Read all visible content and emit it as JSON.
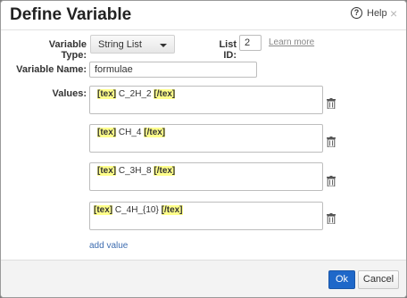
{
  "dialog": {
    "title": "Define Variable",
    "help_label": "Help",
    "close_glyph": "×"
  },
  "form": {
    "variable_type_label": "Variable Type:",
    "variable_type_value": "String List",
    "list_id_label": "List ID:",
    "list_id_value": "2",
    "learn_more": "Learn more",
    "variable_name_label": "Variable Name:",
    "variable_name_value": "formulae",
    "values_label": "Values:",
    "values": [
      {
        "open": "[tex]",
        "text": " C_2H_2 ",
        "close": "[/tex]"
      },
      {
        "open": "[tex]",
        "text": " CH_4 ",
        "close": "[/tex]"
      },
      {
        "open": "[tex]",
        "text": " C_3H_8 ",
        "close": "[/tex]"
      },
      {
        "open": "[tex]",
        "text": " C_4H_{10} ",
        "close": "[/tex]"
      }
    ],
    "add_value": "add value"
  },
  "footer": {
    "ok": "Ok",
    "cancel": "Cancel"
  },
  "icons": {
    "help": "help-circle-icon",
    "delete": "trash-icon",
    "select": "chevron-down-icon",
    "close": "close-icon"
  },
  "colors": {
    "primary_button": "#1f68c9",
    "tex_highlight": "#ffff8a",
    "link": "#3e6db0"
  }
}
